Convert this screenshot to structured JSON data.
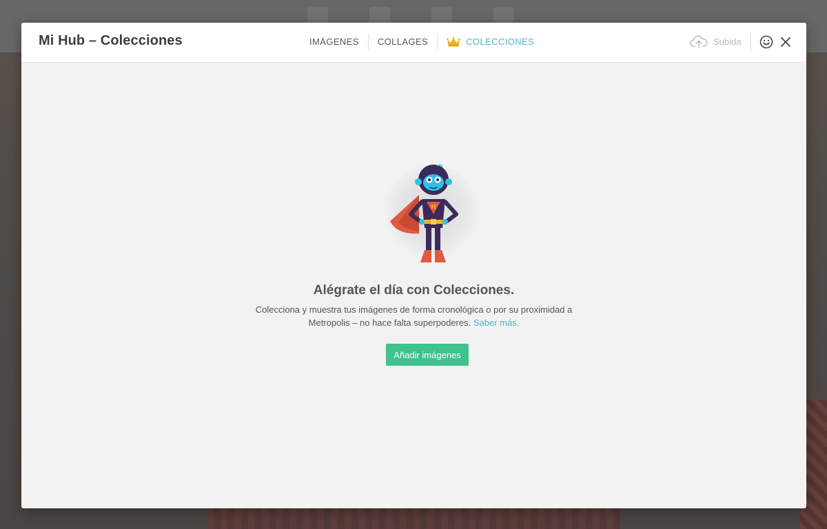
{
  "modal": {
    "title": "Mi Hub – Colecciones",
    "tabs": [
      {
        "label": "IMÁGENES",
        "active": false
      },
      {
        "label": "COLLAGES",
        "active": false
      },
      {
        "label": "COLECCIONES",
        "active": true,
        "icon": "crown-icon"
      }
    ],
    "upload_label": "Subida",
    "upload_icon": "cloud-upload-icon",
    "feedback_icon": "smiley-icon",
    "close_icon": "close-icon"
  },
  "empty_state": {
    "illustration": "superhero-monkey",
    "headline": "Alégrate el día con Colecciones.",
    "description_line1": "Colecciona y muestra tus imágenes de forma cronológica o por su proximidad a",
    "description_line2": "Metropolis – no hace falta superpoderes.",
    "learn_more": "Saber más.",
    "button_label": "Añadir imágenes"
  },
  "colors": {
    "accent": "#4fb3c7",
    "button": "#3ec28f",
    "crown": "#f2b21a"
  }
}
